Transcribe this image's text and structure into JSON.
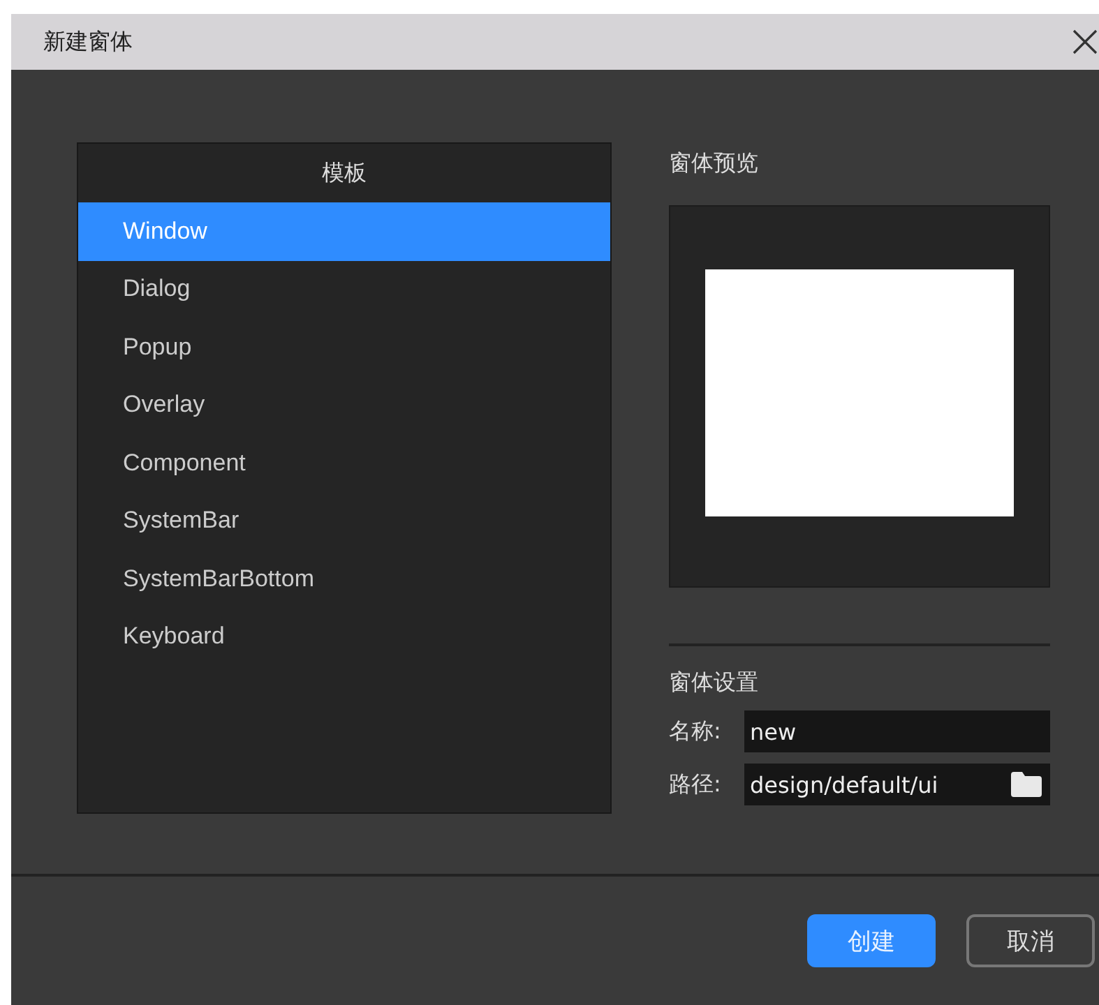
{
  "window": {
    "title": "新建窗体"
  },
  "template_list": {
    "header": "模板",
    "items": [
      {
        "label": "Window",
        "selected": true
      },
      {
        "label": "Dialog",
        "selected": false
      },
      {
        "label": "Popup",
        "selected": false
      },
      {
        "label": "Overlay",
        "selected": false
      },
      {
        "label": "Component",
        "selected": false
      },
      {
        "label": "SystemBar",
        "selected": false
      },
      {
        "label": "SystemBarBottom",
        "selected": false
      },
      {
        "label": "Keyboard",
        "selected": false
      }
    ]
  },
  "preview": {
    "label": "窗体预览"
  },
  "settings": {
    "label": "窗体设置",
    "fields": [
      {
        "label": "名称:",
        "value": "new",
        "kind": "text"
      },
      {
        "label": "路径:",
        "value": "design/default/ui",
        "kind": "folder"
      }
    ]
  },
  "buttons": [
    {
      "label": "创建",
      "kind": "primary"
    },
    {
      "label": "取消",
      "kind": "secondary"
    }
  ]
}
